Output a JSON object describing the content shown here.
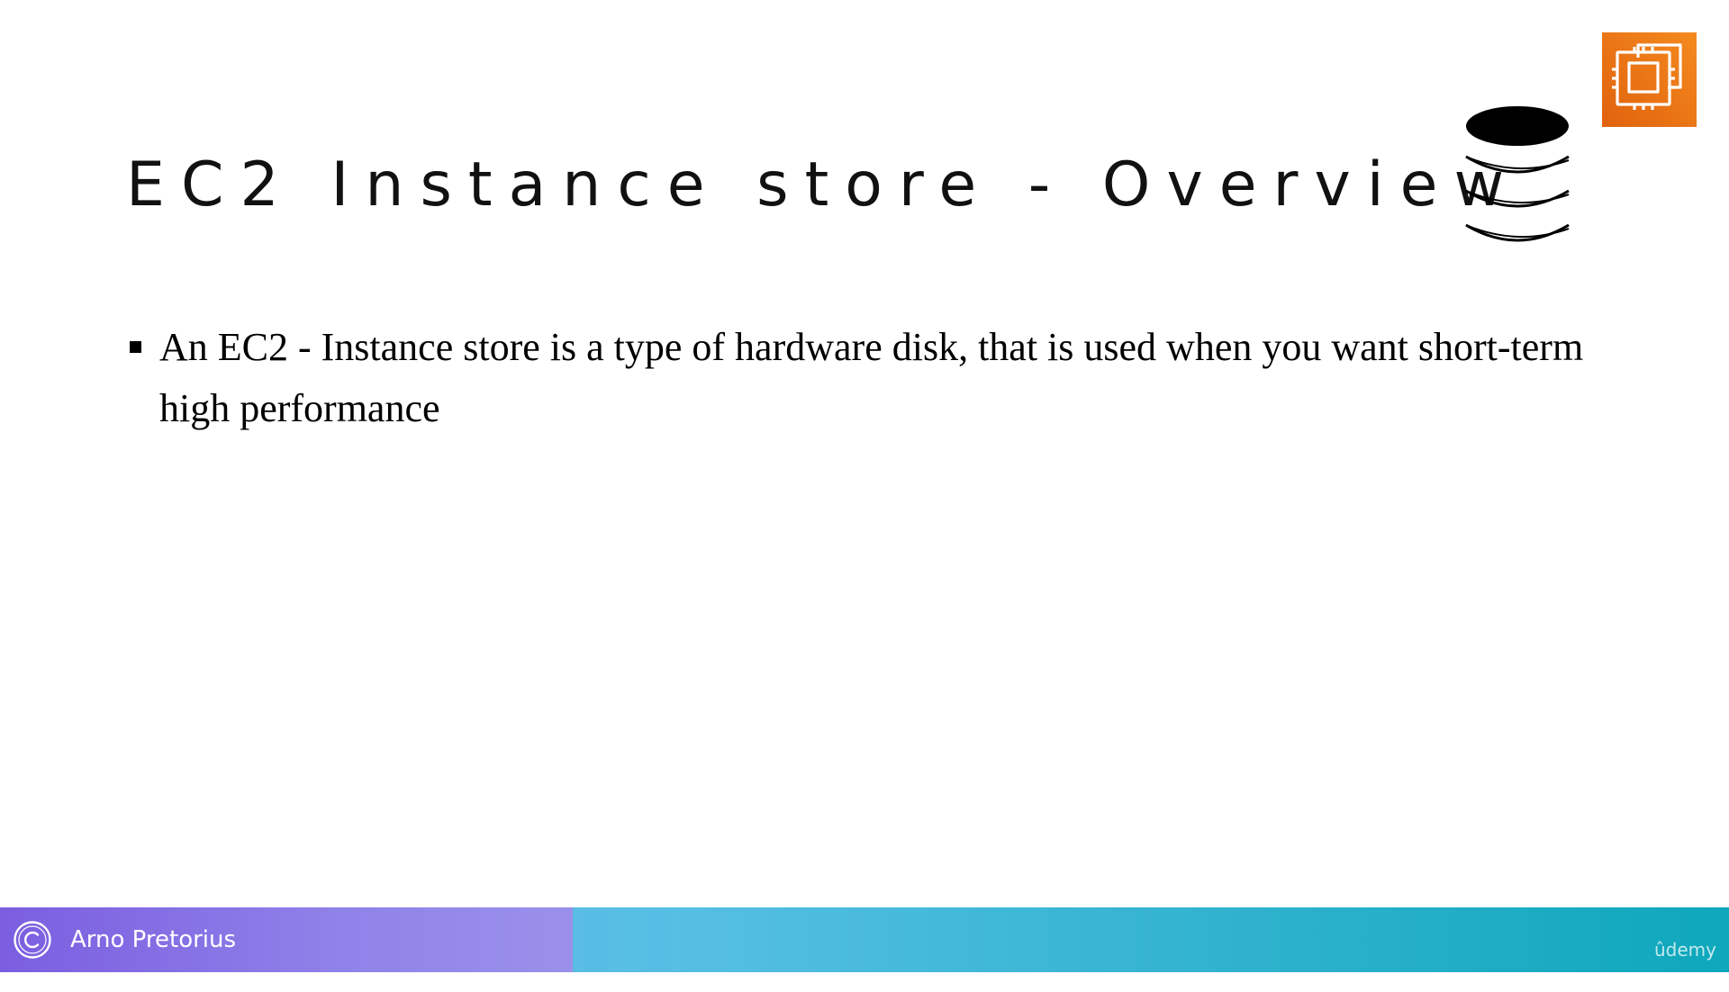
{
  "slide": {
    "title": "EC2 Instance store - Overview",
    "bullets": [
      "An EC2 - Instance store is a type of hardware disk, that is used when you want short-term high performance"
    ],
    "icons": {
      "storage": "database-stack-icon",
      "service": "aws-ec2-icon"
    },
    "colors": {
      "ec2_orange": "#f58a1f",
      "footer_purple": "#7b5ee0",
      "footer_teal": "#0ea7bb"
    }
  },
  "footer": {
    "author": "Arno Pretorius",
    "brand": "ûdemy",
    "icon": "copyright-icon"
  }
}
